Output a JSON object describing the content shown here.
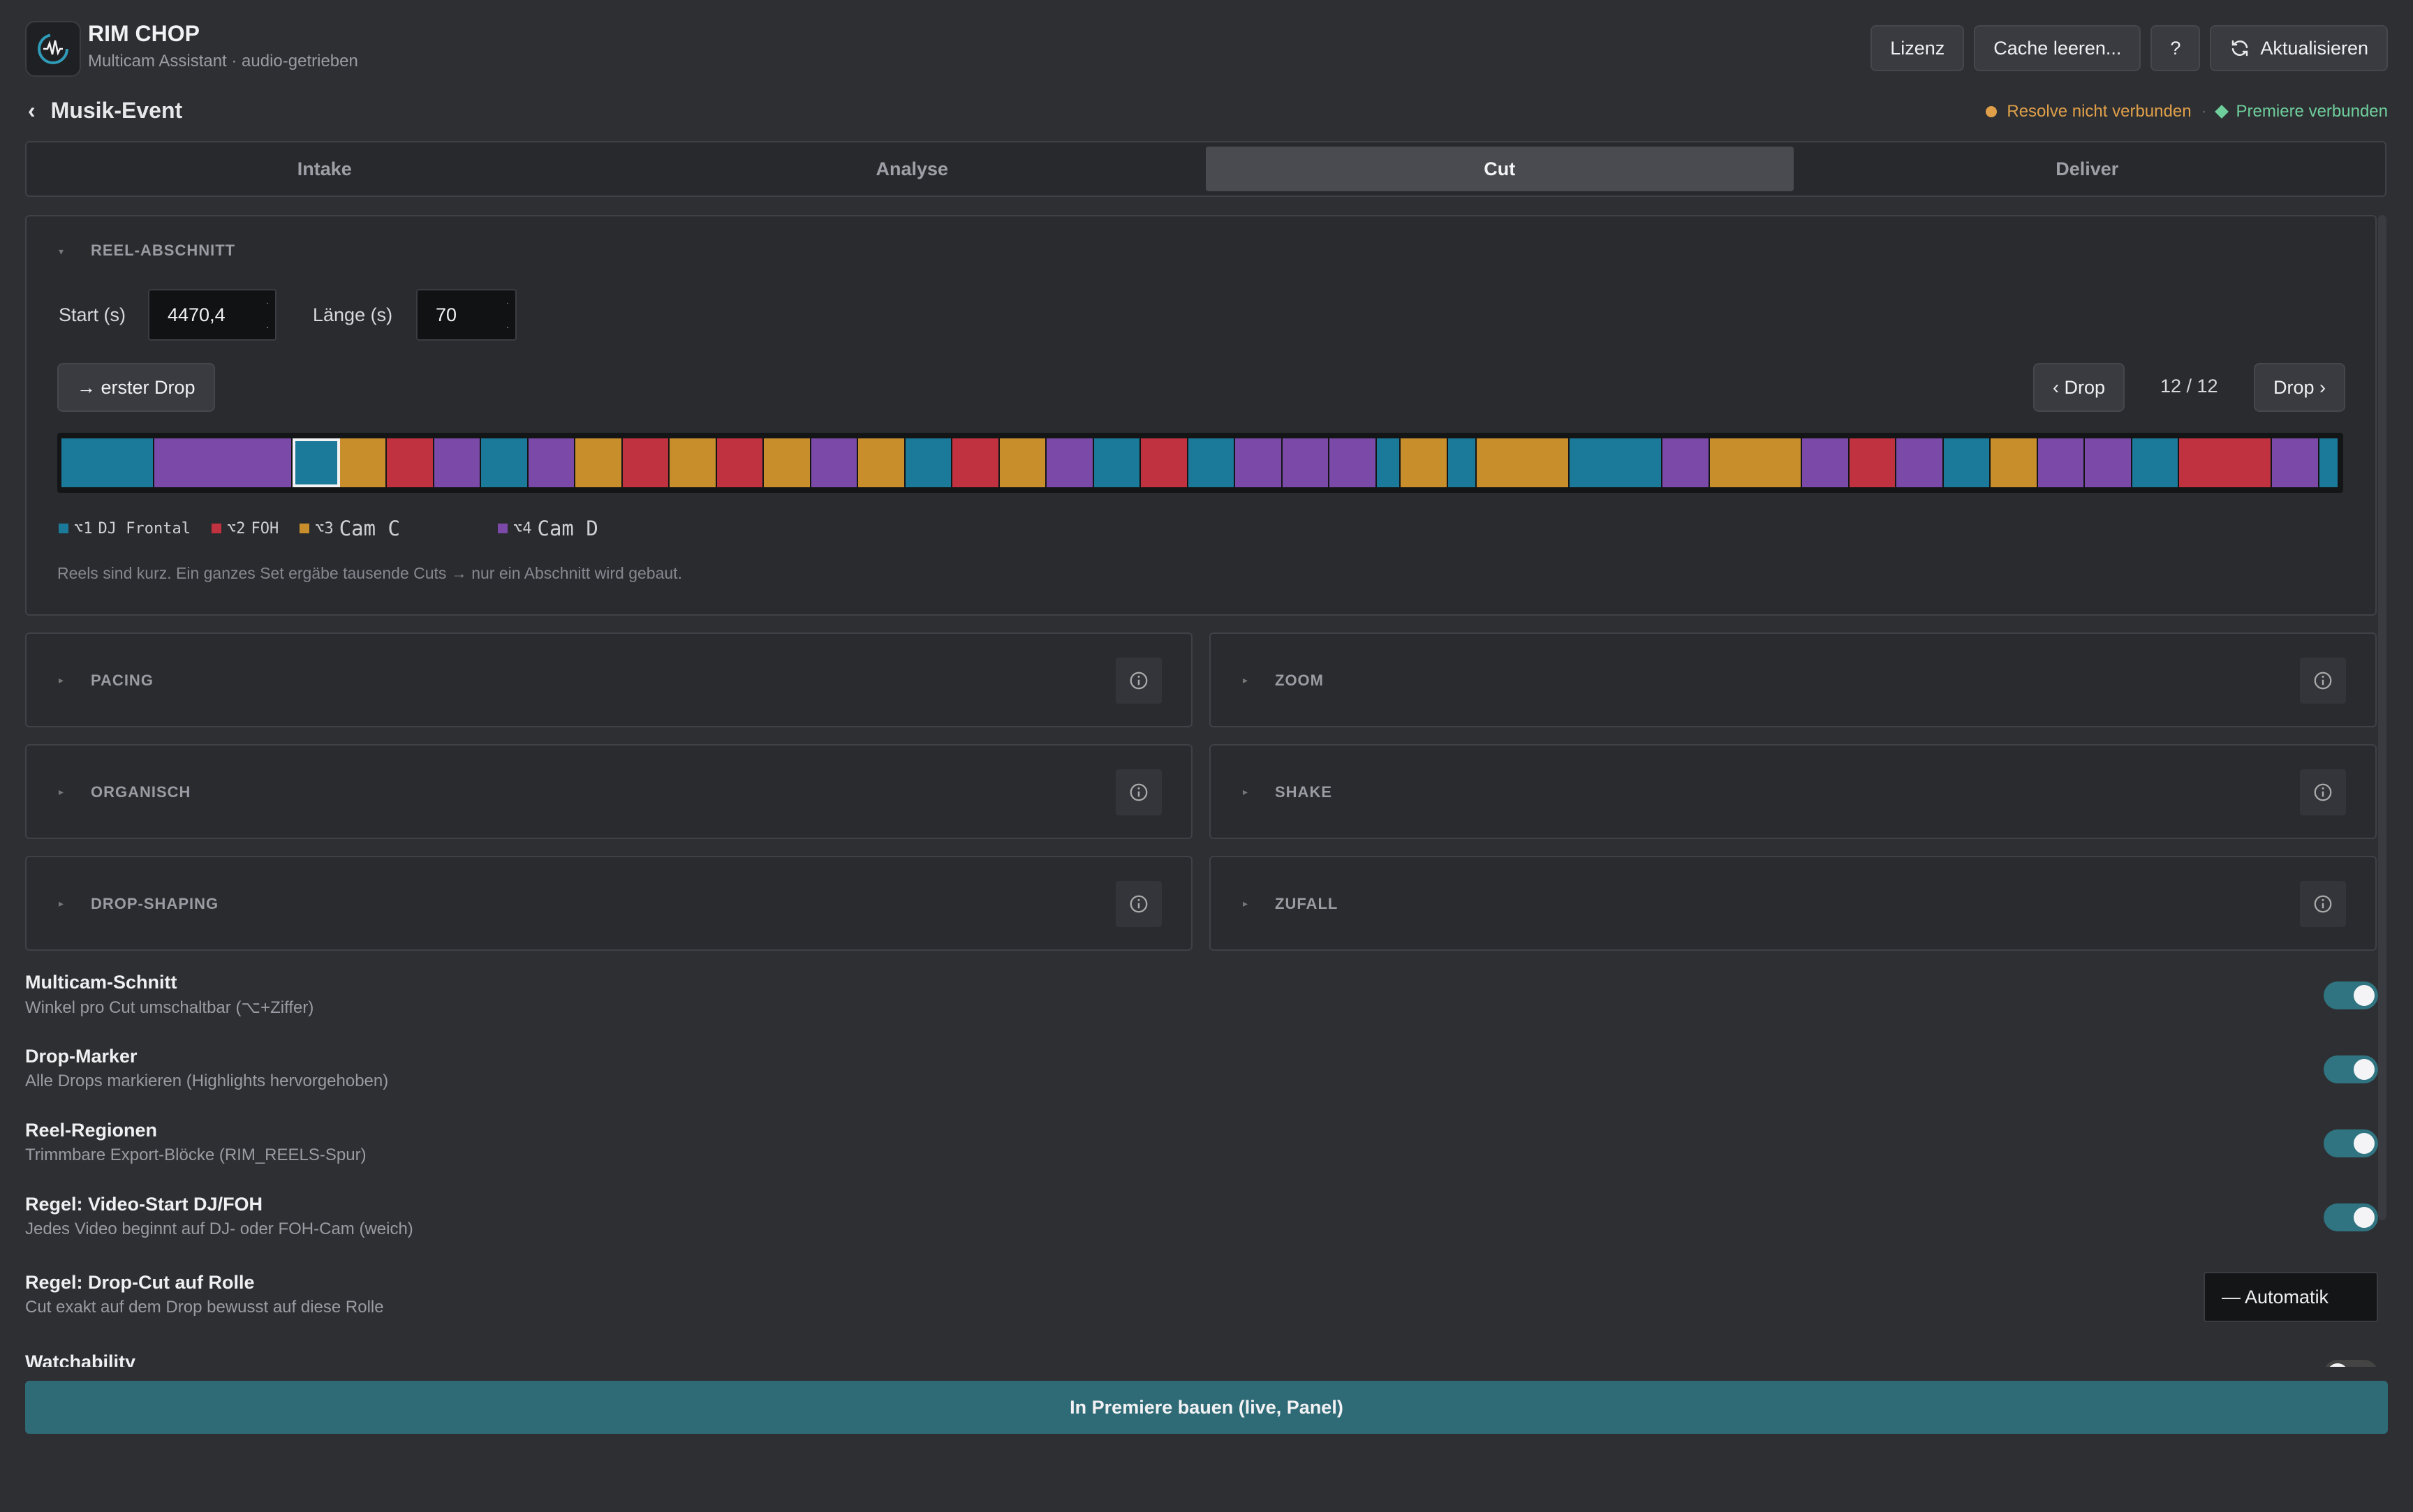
{
  "app": {
    "title": "RIM CHOP",
    "subtitle": "Multicam Assistant · audio-getrieben"
  },
  "header_buttons": {
    "license": "Lizenz",
    "cache": "Cache leeren...",
    "help": "?",
    "refresh": "Aktualisieren"
  },
  "project": {
    "back": "‹",
    "name": "Musik-Event"
  },
  "status": {
    "resolve": "Resolve nicht verbunden",
    "separator": "·",
    "premiere": "Premiere verbunden",
    "resolve_color": "#e0a04a",
    "premiere_color": "#6fcf9c"
  },
  "tabs": [
    "Intake",
    "Analyse",
    "Cut",
    "Deliver"
  ],
  "active_tab": "Cut",
  "reel": {
    "title": "REEL-ABSCHNITT",
    "start_label": "Start (s)",
    "start_value": "4470,4",
    "length_label": "Länge (s)",
    "length_value": "70",
    "first_drop": "→ erster Drop",
    "prev_drop": "‹ Drop",
    "counter": "12 / 12",
    "next_drop": "Drop ›",
    "hint": "Reels sind kurz. Ein ganzes Set ergäbe tausende Cuts → nur ein Abschnitt wird gebaut."
  },
  "legend": [
    {
      "key": "⌥1",
      "label": "DJ Frontal",
      "color": "#1b7a9a",
      "big": false
    },
    {
      "key": "⌥2",
      "label": "FOH",
      "color": "#c0323f",
      "big": false
    },
    {
      "key": "⌥3",
      "label": "Cam C",
      "color": "#c98e2c",
      "big": true
    },
    {
      "key": "⌥4",
      "label": "Cam D",
      "color": "#7b4aa8",
      "big": true
    }
  ],
  "segments": [
    {
      "cam": 1,
      "w": 2
    },
    {
      "cam": 4,
      "w": 3
    },
    {
      "cam": 1,
      "w": 1,
      "sel": true
    },
    {
      "cam": 3,
      "w": 1
    },
    {
      "cam": 2,
      "w": 1
    },
    {
      "cam": 4,
      "w": 1
    },
    {
      "cam": 1,
      "w": 1
    },
    {
      "cam": 4,
      "w": 1
    },
    {
      "cam": 3,
      "w": 1
    },
    {
      "cam": 2,
      "w": 1
    },
    {
      "cam": 3,
      "w": 1
    },
    {
      "cam": 2,
      "w": 1
    },
    {
      "cam": 3,
      "w": 1
    },
    {
      "cam": 4,
      "w": 1
    },
    {
      "cam": 3,
      "w": 1
    },
    {
      "cam": 1,
      "w": 1
    },
    {
      "cam": 2,
      "w": 1
    },
    {
      "cam": 3,
      "w": 1
    },
    {
      "cam": 4,
      "w": 1
    },
    {
      "cam": 1,
      "w": 1
    },
    {
      "cam": 2,
      "w": 1
    },
    {
      "cam": 1,
      "w": 1
    },
    {
      "cam": 4,
      "w": 1
    },
    {
      "cam": 4,
      "w": 1
    },
    {
      "cam": 4,
      "w": 1
    },
    {
      "cam": 1,
      "w": 0.5
    },
    {
      "cam": 3,
      "w": 1
    },
    {
      "cam": 1,
      "w": 0.6
    },
    {
      "cam": 3,
      "w": 2
    },
    {
      "cam": 1,
      "w": 2
    },
    {
      "cam": 4,
      "w": 1
    },
    {
      "cam": 3,
      "w": 2
    },
    {
      "cam": 4,
      "w": 1
    },
    {
      "cam": 2,
      "w": 1
    },
    {
      "cam": 4,
      "w": 1
    },
    {
      "cam": 1,
      "w": 1
    },
    {
      "cam": 3,
      "w": 1
    },
    {
      "cam": 4,
      "w": 1
    },
    {
      "cam": 4,
      "w": 1
    },
    {
      "cam": 1,
      "w": 1
    },
    {
      "cam": 2,
      "w": 2
    },
    {
      "cam": 4,
      "w": 1
    },
    {
      "cam": 1,
      "w": 0.4
    }
  ],
  "sections": [
    {
      "title": "PACING"
    },
    {
      "title": "ZOOM"
    },
    {
      "title": "ORGANISCH"
    },
    {
      "title": "SHAKE"
    },
    {
      "title": "DROP-SHAPING"
    },
    {
      "title": "ZUFALL"
    }
  ],
  "toggles": [
    {
      "title": "Multicam-Schnitt",
      "sub": "Winkel pro Cut umschaltbar (⌥+Ziffer)",
      "on": true
    },
    {
      "title": "Drop-Marker",
      "sub": "Alle Drops markieren (Highlights hervorgehoben)",
      "on": true
    },
    {
      "title": "Reel-Regionen",
      "sub": "Trimmbare Export-Blöcke (RIM_REELS-Spur)",
      "on": true
    },
    {
      "title": "Regel: Video-Start DJ/FOH",
      "sub": "Jedes Video beginnt auf DJ- oder FOH-Cam (weich)",
      "on": true
    }
  ],
  "drop_cut": {
    "title": "Regel: Drop-Cut auf Rolle",
    "sub": "Cut exakt auf dem Drop bewusst auf diese Rolle",
    "select": "— Automatik"
  },
  "watchability": {
    "title": "Watchability"
  },
  "build_button": "In Premiere bauen (live, Panel)"
}
